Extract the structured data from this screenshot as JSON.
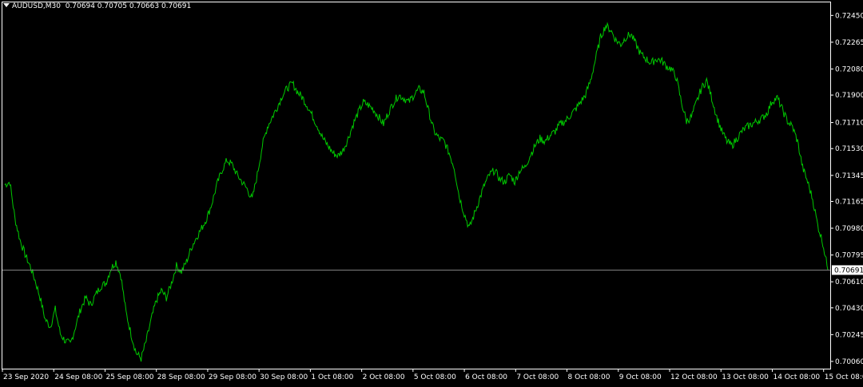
{
  "header": {
    "symbol_tf": "AUDUSD,M30",
    "ohlc": "0.70694 0.70705 0.70663 0.70691"
  },
  "chart_data": {
    "type": "line",
    "title": "AUDUSD,M30",
    "ylim": [
      0.7001,
      0.7254
    ],
    "y_ticks": [
      "0.72450",
      "0.72265",
      "0.72080",
      "0.71900",
      "0.71710",
      "0.71530",
      "0.71345",
      "0.71165",
      "0.70980",
      "0.70795",
      "0.70610",
      "0.70430",
      "0.70245",
      "0.70060"
    ],
    "x_ticks": [
      "23 Sep 2020",
      "24 Sep 08:00",
      "25 Sep 08:00",
      "28 Sep 08:00",
      "29 Sep 08:00",
      "30 Sep 08:00",
      "1 Oct 08:00",
      "2 Oct 08:00",
      "5 Oct 08:00",
      "6 Oct 08:00",
      "7 Oct 08:00",
      "8 Oct 08:00",
      "9 Oct 08:00",
      "12 Oct 08:00",
      "13 Oct 08:00",
      "14 Oct 08:00",
      "15 Oct 08:00"
    ],
    "current_price": "0.70691",
    "grid": false,
    "colors": {
      "line": "#00c800",
      "axis": "#ffffff",
      "price_line": "#808080",
      "background": "#000000"
    },
    "series": [
      {
        "values": [
          0.7128,
          0.713,
          0.7105,
          0.709,
          0.708,
          0.7072,
          0.7062,
          0.705,
          0.7035,
          0.703,
          0.7042,
          0.7025,
          0.702,
          0.7018,
          0.703,
          0.7042,
          0.705,
          0.7045,
          0.7052,
          0.7058,
          0.706,
          0.707,
          0.7075,
          0.7065,
          0.704,
          0.7025,
          0.7012,
          0.7008,
          0.702,
          0.7035,
          0.7048,
          0.7055,
          0.705,
          0.706,
          0.7072,
          0.7068,
          0.7075,
          0.7085,
          0.7092,
          0.7098,
          0.7105,
          0.7115,
          0.7128,
          0.7138,
          0.7145,
          0.7142,
          0.7135,
          0.713,
          0.7125,
          0.7118,
          0.7135,
          0.7155,
          0.7168,
          0.7175,
          0.7182,
          0.719,
          0.7195,
          0.7198,
          0.7192,
          0.7188,
          0.7182,
          0.7175,
          0.7168,
          0.716,
          0.7155,
          0.715,
          0.7148,
          0.7152,
          0.716,
          0.717,
          0.7178,
          0.7185,
          0.7183,
          0.718,
          0.7175,
          0.717,
          0.7178,
          0.7185,
          0.719,
          0.7188,
          0.7185,
          0.719,
          0.7194,
          0.7192,
          0.7178,
          0.7165,
          0.716,
          0.7158,
          0.715,
          0.714,
          0.712,
          0.7108,
          0.7098,
          0.7108,
          0.7118,
          0.7128,
          0.7135,
          0.7138,
          0.7132,
          0.713,
          0.7135,
          0.713,
          0.7138,
          0.714,
          0.7148,
          0.7155,
          0.716,
          0.7158,
          0.7162,
          0.7165,
          0.717,
          0.7172,
          0.7176,
          0.718,
          0.7185,
          0.719,
          0.72,
          0.7215,
          0.723,
          0.7238,
          0.7235,
          0.7228,
          0.7225,
          0.723,
          0.7232,
          0.7225,
          0.7218,
          0.7215,
          0.7212,
          0.7215,
          0.7214,
          0.721,
          0.7208,
          0.7202,
          0.7185,
          0.7172,
          0.7175,
          0.7185,
          0.7195,
          0.72,
          0.7188,
          0.7175,
          0.7165,
          0.7158,
          0.7155,
          0.716,
          0.7165,
          0.7168,
          0.717,
          0.7172,
          0.7174,
          0.7178,
          0.7186,
          0.7188,
          0.718,
          0.7172,
          0.7168,
          0.7158,
          0.714,
          0.713,
          0.7118,
          0.71,
          0.7088,
          0.70691
        ]
      }
    ]
  }
}
